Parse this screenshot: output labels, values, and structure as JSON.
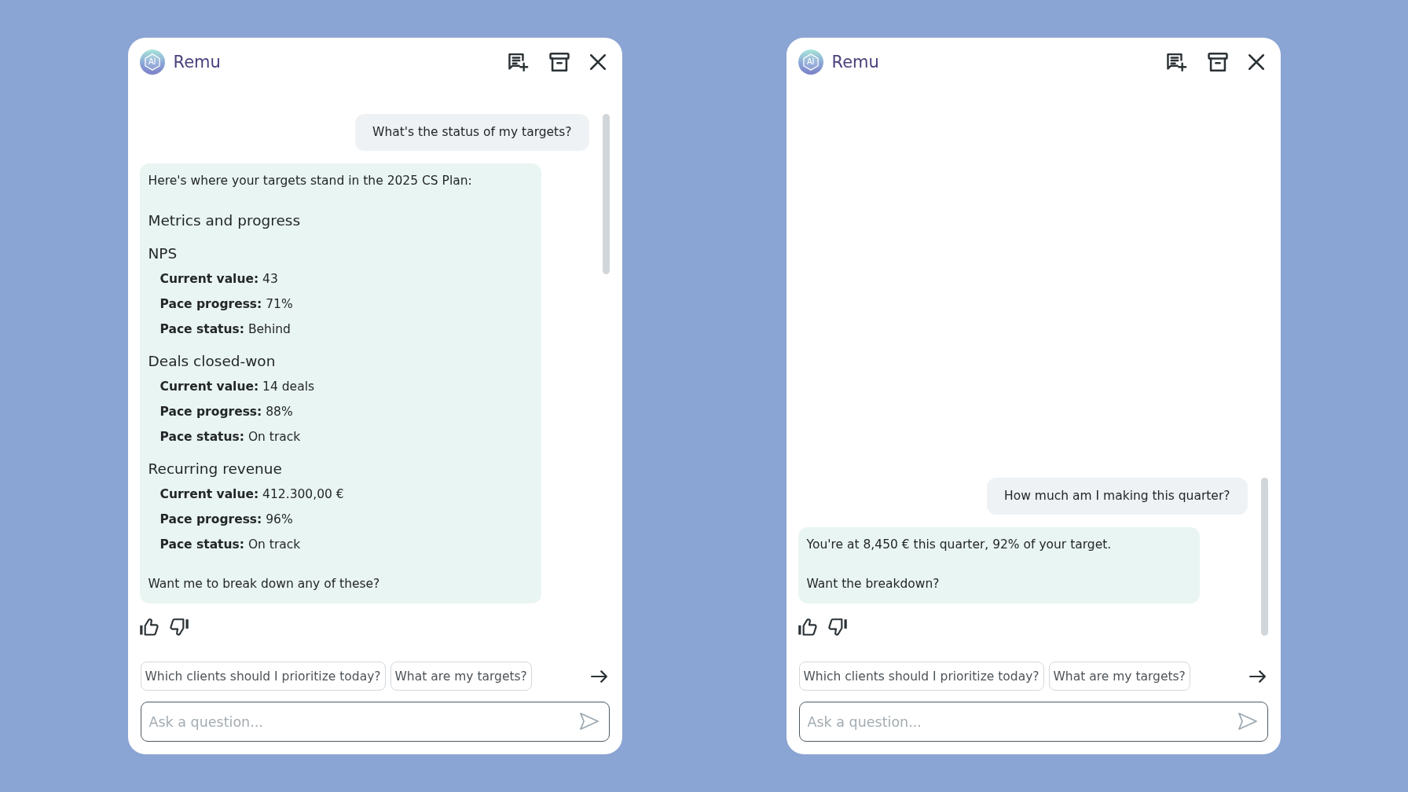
{
  "panels": [
    {
      "header": {
        "logo_text": "AI",
        "title": "Remu"
      },
      "messages": [
        {
          "kind": "user",
          "text": "What's the status of my targets?"
        },
        {
          "kind": "assistant",
          "blocks": [
            {
              "kind": "paragraph",
              "text": "Here's where your targets stand in the 2025 CS Plan:"
            },
            {
              "kind": "heading",
              "text": "Metrics and progress"
            },
            {
              "kind": "section",
              "title": "NPS",
              "items": [
                "**Current value:** 43",
                "**Pace progress:** 71%",
                "**Pace status:** Behind"
              ]
            },
            {
              "kind": "section",
              "title": "Deals closed-won",
              "items": [
                "**Current value:** 14 deals",
                "**Pace progress:** 88%",
                "**Pace status:** On track"
              ]
            },
            {
              "kind": "section",
              "title": "Recurring revenue",
              "items": [
                "**Current value:** 412.300,00 €",
                "**Pace progress:** 96%",
                "**Pace status:** On track"
              ]
            },
            {
              "kind": "paragraph",
              "text": "Want me to break down any of these?"
            }
          ]
        }
      ],
      "suggestions": [
        "Which clients should I prioritize today?",
        "What are my targets?"
      ],
      "input": {
        "placeholder": "Ask a question..."
      }
    },
    {
      "header": {
        "logo_text": "AI",
        "title": "Remu"
      },
      "messages": [
        {
          "kind": "user",
          "text": "How much am I making this quarter?"
        },
        {
          "kind": "assistant",
          "blocks": [
            {
              "kind": "paragraph",
              "text": "You're at 8,450 € this quarter, 92% of your target."
            },
            {
              "kind": "paragraph",
              "text": "Want the breakdown?"
            }
          ]
        }
      ],
      "suggestions": [
        "Which clients should I prioritize today?",
        "What are my targets?"
      ],
      "input": {
        "placeholder": "Ask a question..."
      }
    }
  ]
}
